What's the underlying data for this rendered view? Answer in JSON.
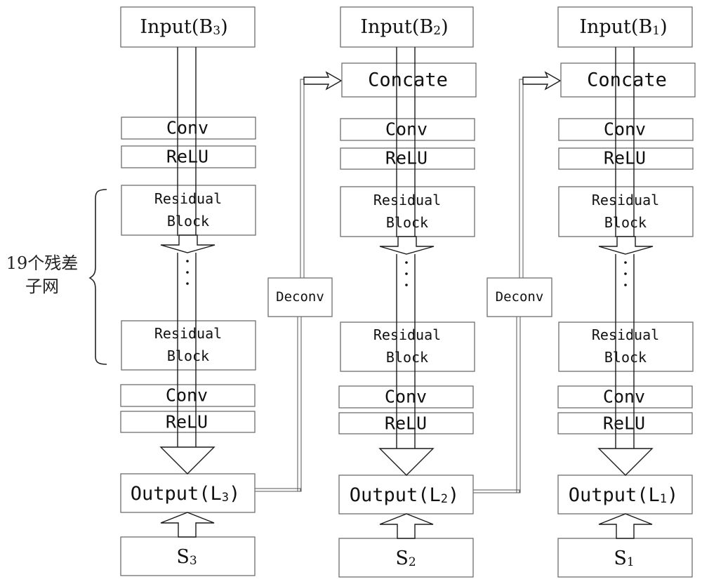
{
  "diagram": {
    "columns": [
      {
        "id": "branch-3",
        "input": {
          "label": "Input(B",
          "sub": "3",
          "close": ")"
        },
        "concat": null,
        "conv_top": "Conv",
        "relu_top": "ReLU",
        "residual_first": {
          "line1": "Residual",
          "line2": "Block"
        },
        "residual_last": {
          "line1": "Residual",
          "line2": "Block"
        },
        "ellipsis": "⋮",
        "conv_bottom": "Conv",
        "relu_bottom": "ReLU",
        "output": {
          "label": "Output(L",
          "sub": "3",
          "close": ")"
        },
        "skip": {
          "label": "S",
          "sub": "3"
        }
      },
      {
        "id": "branch-2",
        "input": {
          "label": "Input(B",
          "sub": "2",
          "close": ")"
        },
        "concat": "Concate",
        "conv_top": "Conv",
        "relu_top": "ReLU",
        "residual_first": {
          "line1": "Residual",
          "line2": "Block"
        },
        "residual_last": {
          "line1": "Residual",
          "line2": "Block"
        },
        "ellipsis": "⋮",
        "conv_bottom": "Conv",
        "relu_bottom": "ReLU",
        "output": {
          "label": "Output(L",
          "sub": "2",
          "close": ")"
        },
        "skip": {
          "label": "S",
          "sub": "2"
        }
      },
      {
        "id": "branch-1",
        "input": {
          "label": "Input(B",
          "sub": "1",
          "close": ")"
        },
        "concat": "Concate",
        "conv_top": "Conv",
        "relu_top": "ReLU",
        "residual_first": {
          "line1": "Residual",
          "line2": "Block"
        },
        "residual_last": {
          "line1": "Residual",
          "line2": "Block"
        },
        "ellipsis": "⋮",
        "conv_bottom": "Conv",
        "relu_bottom": "ReLU",
        "output": {
          "label": "Output(L",
          "sub": "1",
          "close": ")"
        },
        "skip": {
          "label": "S",
          "sub": "1"
        }
      }
    ],
    "deconv": [
      {
        "label": "Deconv",
        "from": "Output(L3)",
        "to": "Concate (branch 2)"
      },
      {
        "label": "Deconv",
        "from": "Output(L2)",
        "to": "Concate (branch 1)"
      }
    ],
    "annotation": {
      "line1": "19个残差",
      "line2": "子网",
      "meaning": "19 residual sub-networks"
    }
  }
}
